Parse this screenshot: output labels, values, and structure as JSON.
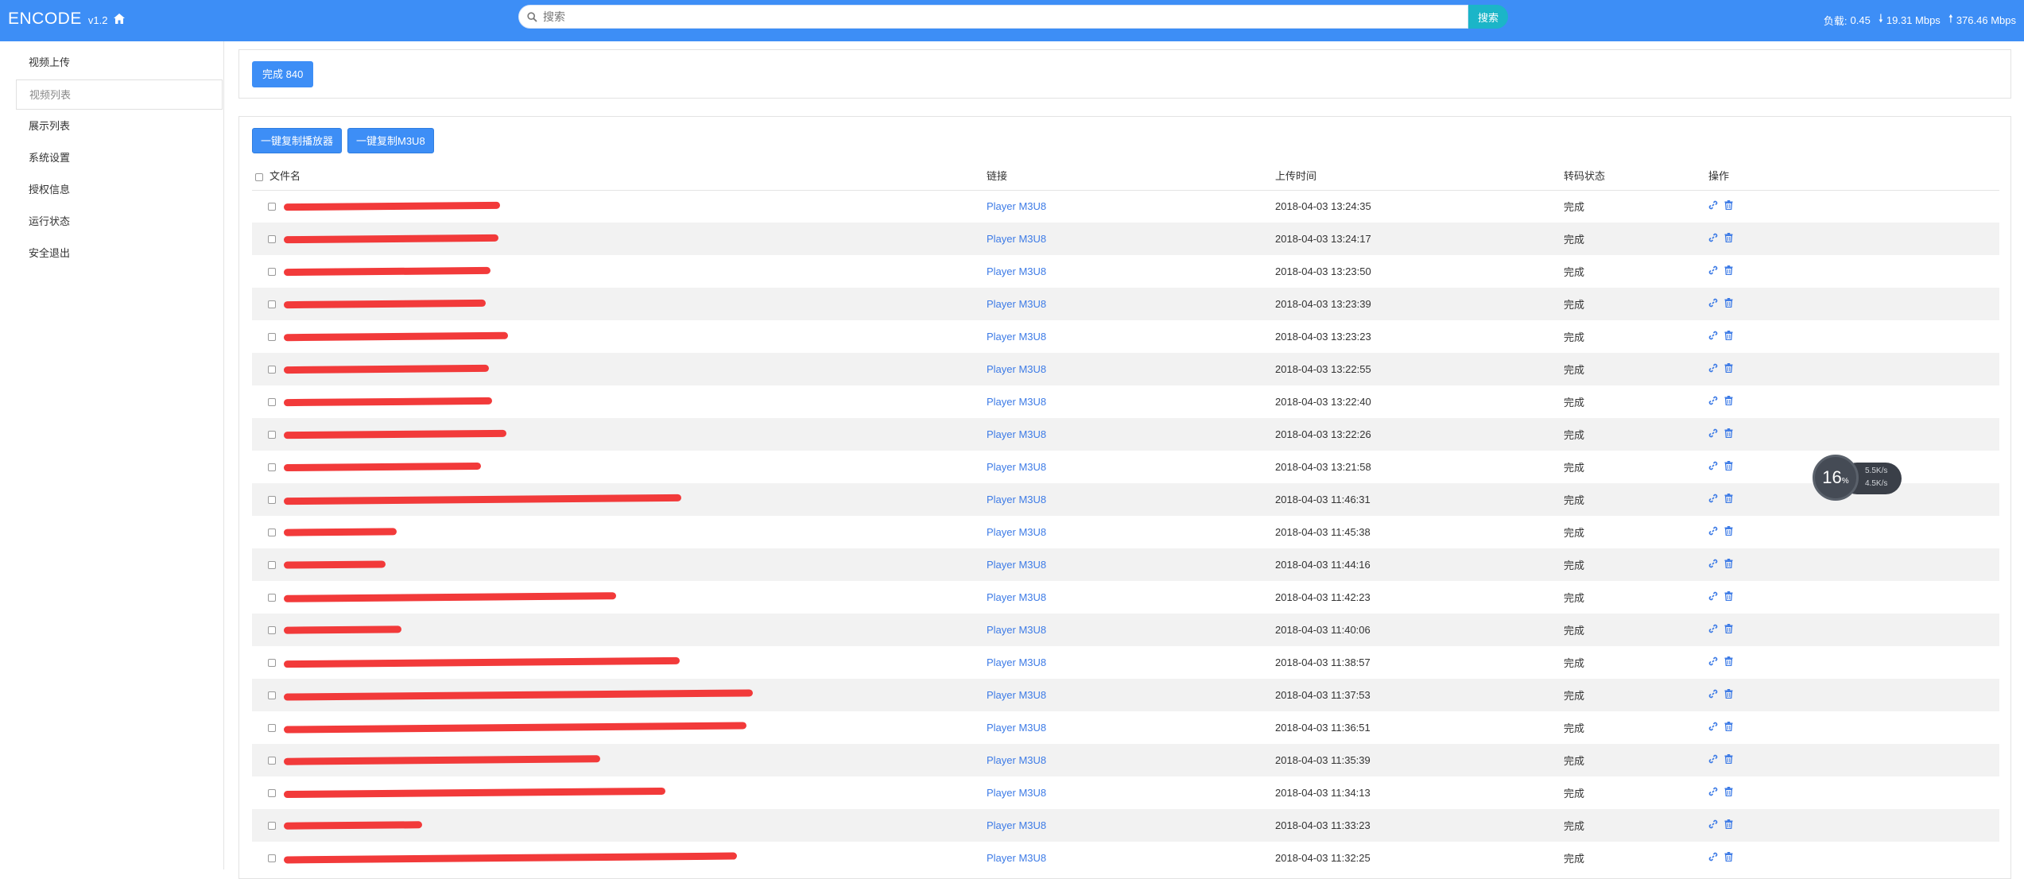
{
  "header": {
    "brand": "ENCODE",
    "version": "v1.2",
    "search_placeholder": "搜索",
    "search_button": "搜索",
    "load_label": "负载:",
    "load_value": "0.45",
    "down_speed": "19.31 Mbps",
    "up_speed": "376.46 Mbps"
  },
  "sidebar": {
    "items": [
      {
        "label": "视频上传"
      },
      {
        "label": "视频列表"
      },
      {
        "label": "展示列表"
      },
      {
        "label": "系统设置"
      },
      {
        "label": "授权信息"
      },
      {
        "label": "运行状态"
      },
      {
        "label": "安全退出"
      }
    ]
  },
  "summary": {
    "done_label": "完成 840"
  },
  "toolbar": {
    "copy_player": "一键复制播放器",
    "copy_m3u8": "一键复制M3U8"
  },
  "table": {
    "headers": {
      "name": "文件名",
      "link": "链接",
      "time": "上传时间",
      "status": "转码状态",
      "ops": "操作"
    },
    "rows": [
      {
        "link": "Player M3U8",
        "time": "2018-04-03 13:24:35",
        "status": "完成"
      },
      {
        "link": "Player M3U8",
        "time": "2018-04-03 13:24:17",
        "status": "完成"
      },
      {
        "link": "Player M3U8",
        "time": "2018-04-03 13:23:50",
        "status": "完成"
      },
      {
        "link": "Player M3U8",
        "time": "2018-04-03 13:23:39",
        "status": "完成"
      },
      {
        "link": "Player M3U8",
        "time": "2018-04-03 13:23:23",
        "status": "完成"
      },
      {
        "link": "Player M3U8",
        "time": "2018-04-03 13:22:55",
        "status": "完成"
      },
      {
        "link": "Player M3U8",
        "time": "2018-04-03 13:22:40",
        "status": "完成"
      },
      {
        "link": "Player M3U8",
        "time": "2018-04-03 13:22:26",
        "status": "完成"
      },
      {
        "link": "Player M3U8",
        "time": "2018-04-03 13:21:58",
        "status": "完成"
      },
      {
        "link": "Player M3U8",
        "time": "2018-04-03 11:46:31",
        "status": "完成"
      },
      {
        "link": "Player M3U8",
        "time": "2018-04-03 11:45:38",
        "status": "完成"
      },
      {
        "link": "Player M3U8",
        "time": "2018-04-03 11:44:16",
        "status": "完成"
      },
      {
        "link": "Player M3U8",
        "time": "2018-04-03 11:42:23",
        "status": "完成"
      },
      {
        "link": "Player M3U8",
        "time": "2018-04-03 11:40:06",
        "status": "完成"
      },
      {
        "link": "Player M3U8",
        "time": "2018-04-03 11:38:57",
        "status": "完成"
      },
      {
        "link": "Player M3U8",
        "time": "2018-04-03 11:37:53",
        "status": "完成"
      },
      {
        "link": "Player M3U8",
        "time": "2018-04-03 11:36:51",
        "status": "完成"
      },
      {
        "link": "Player M3U8",
        "time": "2018-04-03 11:35:39",
        "status": "完成"
      },
      {
        "link": "Player M3U8",
        "time": "2018-04-03 11:34:13",
        "status": "完成"
      },
      {
        "link": "Player M3U8",
        "time": "2018-04-03 11:33:23",
        "status": "完成"
      },
      {
        "link": "Player M3U8",
        "time": "2018-04-03 11:32:25",
        "status": "完成"
      }
    ]
  },
  "speed_widget": {
    "percent": "16",
    "percent_unit": "%",
    "up": "5.5K/s",
    "down": "4.5K/s"
  },
  "colors": {
    "accent": "#3d8ef6",
    "search_button": "#1bb5c8",
    "link": "#3d7be6",
    "redaction": "#f23a3a"
  }
}
